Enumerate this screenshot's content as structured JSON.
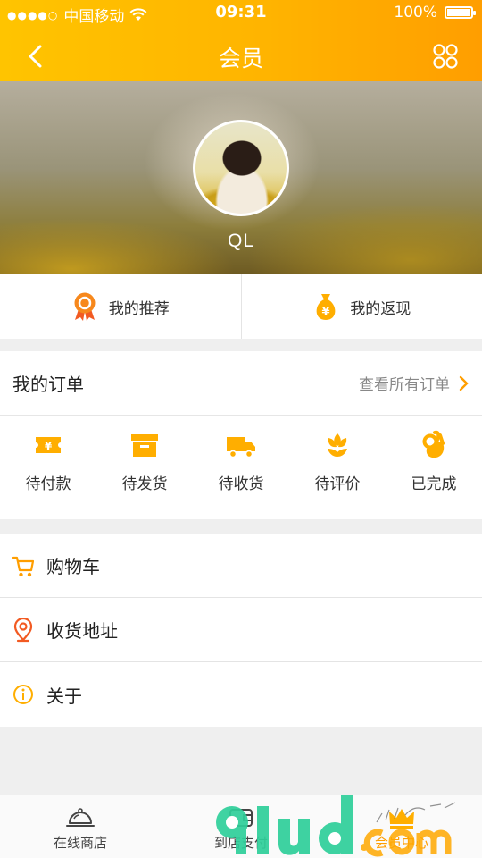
{
  "status_bar": {
    "carrier": "中国移动",
    "time": "09:31",
    "battery": "100%"
  },
  "nav": {
    "title": "会员"
  },
  "profile": {
    "username": "QL"
  },
  "quick_links": [
    {
      "label": "我的推荐",
      "icon": "ribbon-award-icon"
    },
    {
      "label": "我的返现",
      "icon": "money-bag-icon"
    }
  ],
  "orders": {
    "title": "我的订单",
    "view_all": "查看所有订单",
    "statuses": [
      {
        "label": "待付款",
        "icon": "ticket-yen-icon"
      },
      {
        "label": "待发货",
        "icon": "box-icon"
      },
      {
        "label": "待收货",
        "icon": "truck-icon"
      },
      {
        "label": "待评价",
        "icon": "flower-icon"
      },
      {
        "label": "已完成",
        "icon": "ok-hand-icon"
      }
    ]
  },
  "menu": [
    {
      "label": "购物车",
      "icon": "cart-icon"
    },
    {
      "label": "收货地址",
      "icon": "location-pin-icon"
    },
    {
      "label": "关于",
      "icon": "info-icon"
    }
  ],
  "tabbar": [
    {
      "label": "在线商店",
      "icon": "cloche-icon"
    },
    {
      "label": "到店支付",
      "icon": "wallet-icon"
    },
    {
      "label": "会员中心",
      "icon": "crown-icon"
    }
  ],
  "colors": {
    "accent": "#ffa800",
    "accent_dark": "#ff9e00",
    "page_bg": "#efefef"
  }
}
